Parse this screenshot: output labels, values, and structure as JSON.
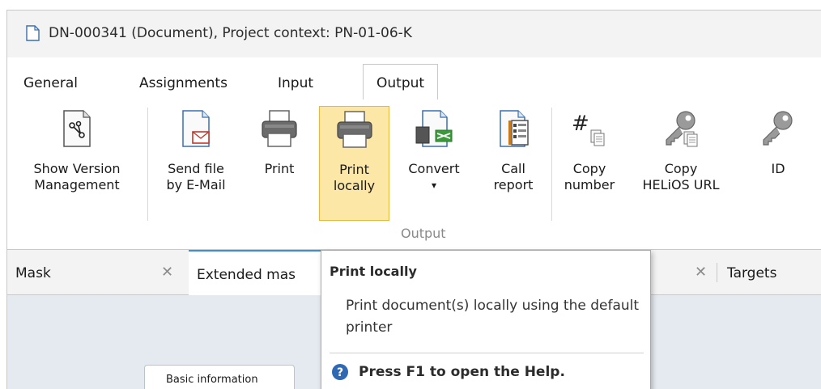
{
  "window": {
    "title": "DN-000341 (Document), Project context: PN-01-06-K"
  },
  "tabs": [
    {
      "label": "General"
    },
    {
      "label": "Assignments"
    },
    {
      "label": "Input"
    },
    {
      "label": "Output",
      "active": true
    }
  ],
  "ribbon": {
    "buttons": [
      {
        "line1": "Show Version",
        "line2": "Management",
        "icon": "version-tree-icon"
      },
      {
        "line1": "Send file",
        "line2": "by E-Mail",
        "icon": "email-file-icon"
      },
      {
        "line1": "Print",
        "line2": "",
        "icon": "printer-icon"
      },
      {
        "line1": "Print",
        "line2": "locally",
        "icon": "printer-icon",
        "highlighted": true
      },
      {
        "line1": "Convert",
        "line2": "▾",
        "icon": "convert-icon"
      },
      {
        "line1": "Call",
        "line2": "report",
        "icon": "report-icon"
      },
      {
        "line1": "Copy",
        "line2": "number",
        "icon": "hash-copy-icon"
      },
      {
        "line1": "Copy",
        "line2": "HELiOS URL",
        "icon": "key-copy-icon"
      },
      {
        "line1": "ID",
        "line2": "",
        "icon": "key-icon"
      }
    ],
    "group_label": "Output"
  },
  "lower_tabs": [
    {
      "label": "Mask"
    },
    {
      "label": "Extended mas",
      "active": true
    },
    {
      "label": "Targets"
    }
  ],
  "content": {
    "subtab_label": "Basic information"
  },
  "tooltip": {
    "title": "Print locally",
    "description": "Print document(s) locally using the default printer",
    "help": "Press F1 to open the Help."
  },
  "colors": {
    "highlight_fill": "#fce7a6",
    "highlight_border": "#e8b83c",
    "active_tab_accent": "#3d8ee0",
    "help_icon": "#2f68b3"
  }
}
